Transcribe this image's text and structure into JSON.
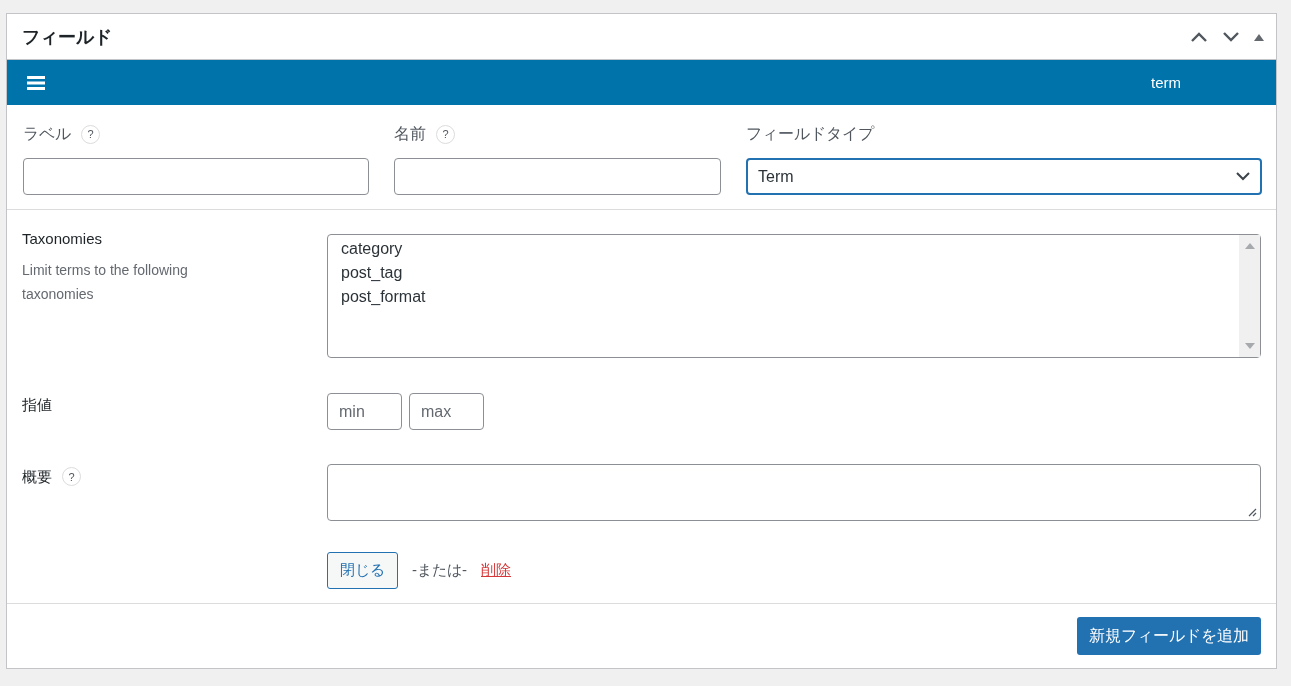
{
  "panel": {
    "title": "フィールド"
  },
  "field_bar": {
    "label": "term"
  },
  "basic_fields": [
    {
      "kind": "text",
      "label": "ラベル",
      "help": "?"
    },
    {
      "kind": "text",
      "label": "名前",
      "help": "?"
    },
    {
      "kind": "select",
      "label": "フィールドタイプ",
      "value": "Term"
    }
  ],
  "settings": [
    {
      "kind": "multiselect",
      "label": "Taxonomies",
      "description": "Limit terms to the following taxonomies",
      "options": [
        {
          "label": "category",
          "selected": false
        },
        {
          "label": "post_tag",
          "selected": false
        },
        {
          "label": "post_format",
          "selected": false
        }
      ]
    },
    {
      "kind": "range",
      "label": "指値",
      "min_placeholder": "min",
      "max_placeholder": "max"
    },
    {
      "kind": "textarea",
      "label": "概要",
      "help": "?"
    }
  ],
  "actions": {
    "close": "閉じる",
    "separator": "-または-",
    "delete": "削除"
  },
  "footer": {
    "add_button": "新規フィールドを追加"
  }
}
